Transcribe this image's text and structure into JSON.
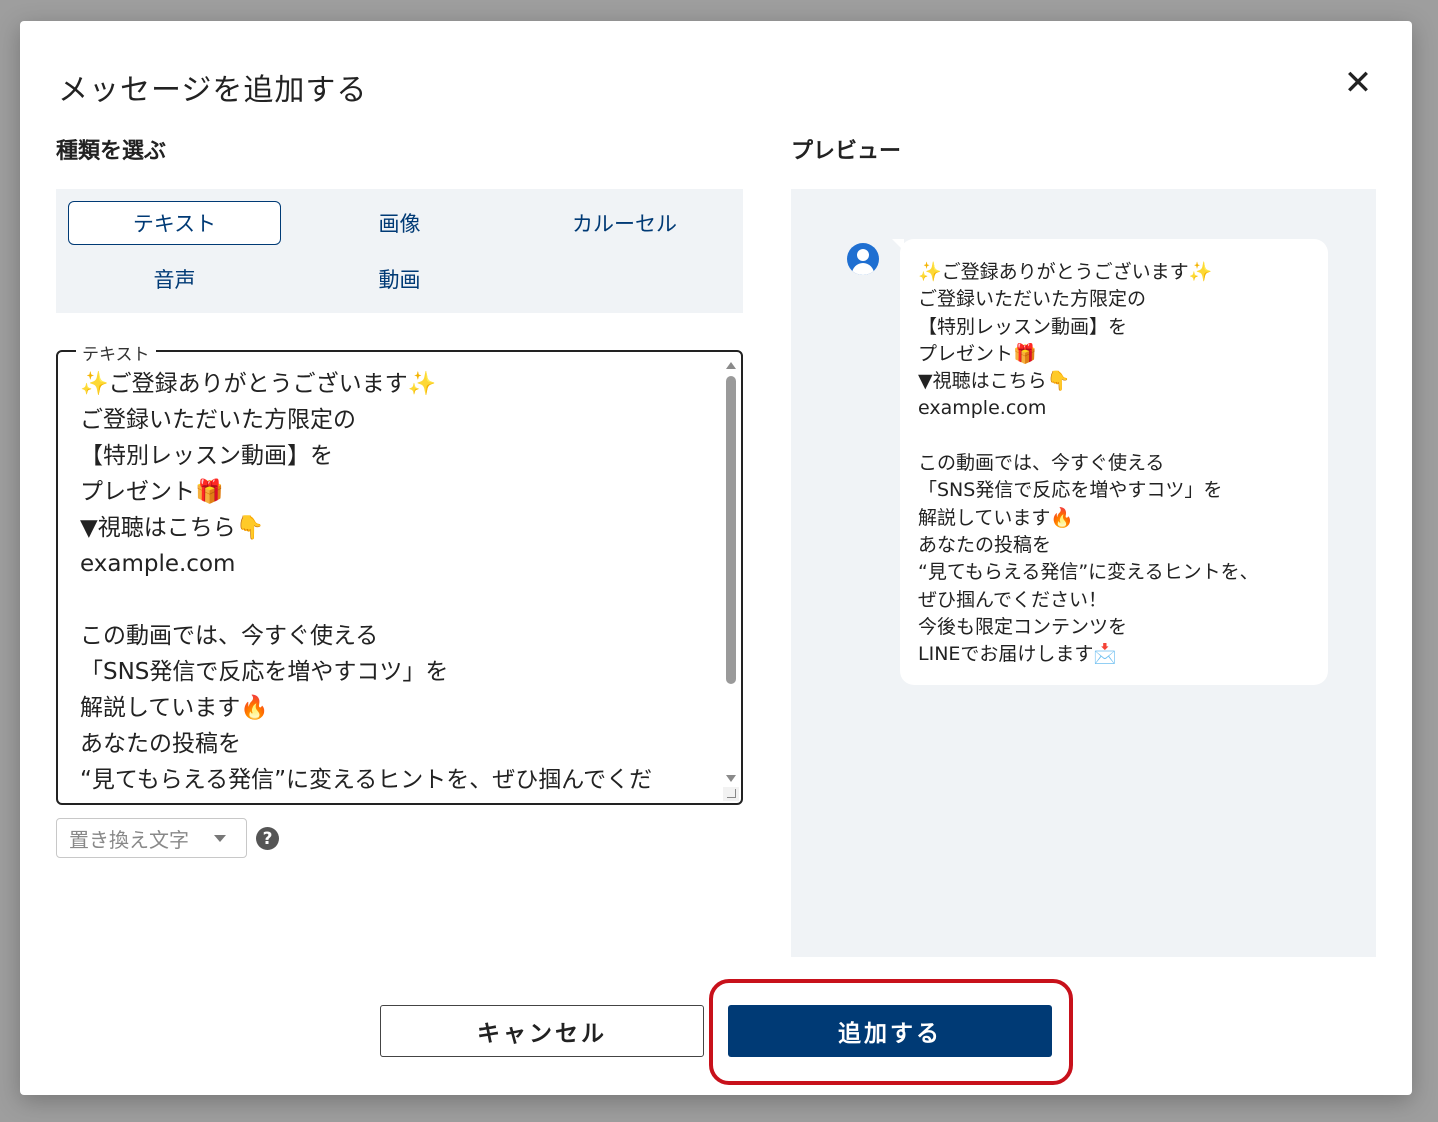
{
  "modal": {
    "title": "メッセージを追加する",
    "close_glyph": "✕"
  },
  "type_section": {
    "label": "種類を選ぶ",
    "options": [
      {
        "label": "テキスト",
        "active": true
      },
      {
        "label": "画像",
        "active": false
      },
      {
        "label": "カルーセル",
        "active": false
      },
      {
        "label": "音声",
        "active": false
      },
      {
        "label": "動画",
        "active": false
      }
    ]
  },
  "text_field": {
    "legend": "テキスト",
    "value": "✨ご登録ありがとうございます✨\nご登録いただいた方限定の\n【特別レッスン動画】を\nプレゼント🎁\n▼視聴はこちら👇\nexample.com\n\nこの動画では、今すぐ使える\n「SNS発信で反応を増やすコツ」を\n解説しています🔥\nあなたの投稿を\n“見てもらえる発信”に変えるヒントを、ぜひ掴んでくだ"
  },
  "replace_select": {
    "placeholder": "置き換え文字",
    "help_glyph": "?"
  },
  "preview": {
    "label": "プレビュー",
    "message": "✨ご登録ありがとうございます✨\nご登録いただいた方限定の\n【特別レッスン動画】を\nプレゼント🎁\n▼視聴はこちら👇\nexample.com\n\nこの動画では、今すぐ使える\n「SNS発信で反応を増やすコツ」を\n解説しています🔥\nあなたの投稿を\n“見てもらえる発信”に変えるヒントを、\nぜひ掴んでください！\n今後も限定コンテンツを\nLINEでお届けします📩"
  },
  "footer": {
    "cancel_label": "キャンセル",
    "add_label": "追加する"
  },
  "colors": {
    "primary": "#003a75",
    "highlight": "#c8111b",
    "panel_bg": "#f0f3f6",
    "avatar": "#1f6fd1"
  }
}
